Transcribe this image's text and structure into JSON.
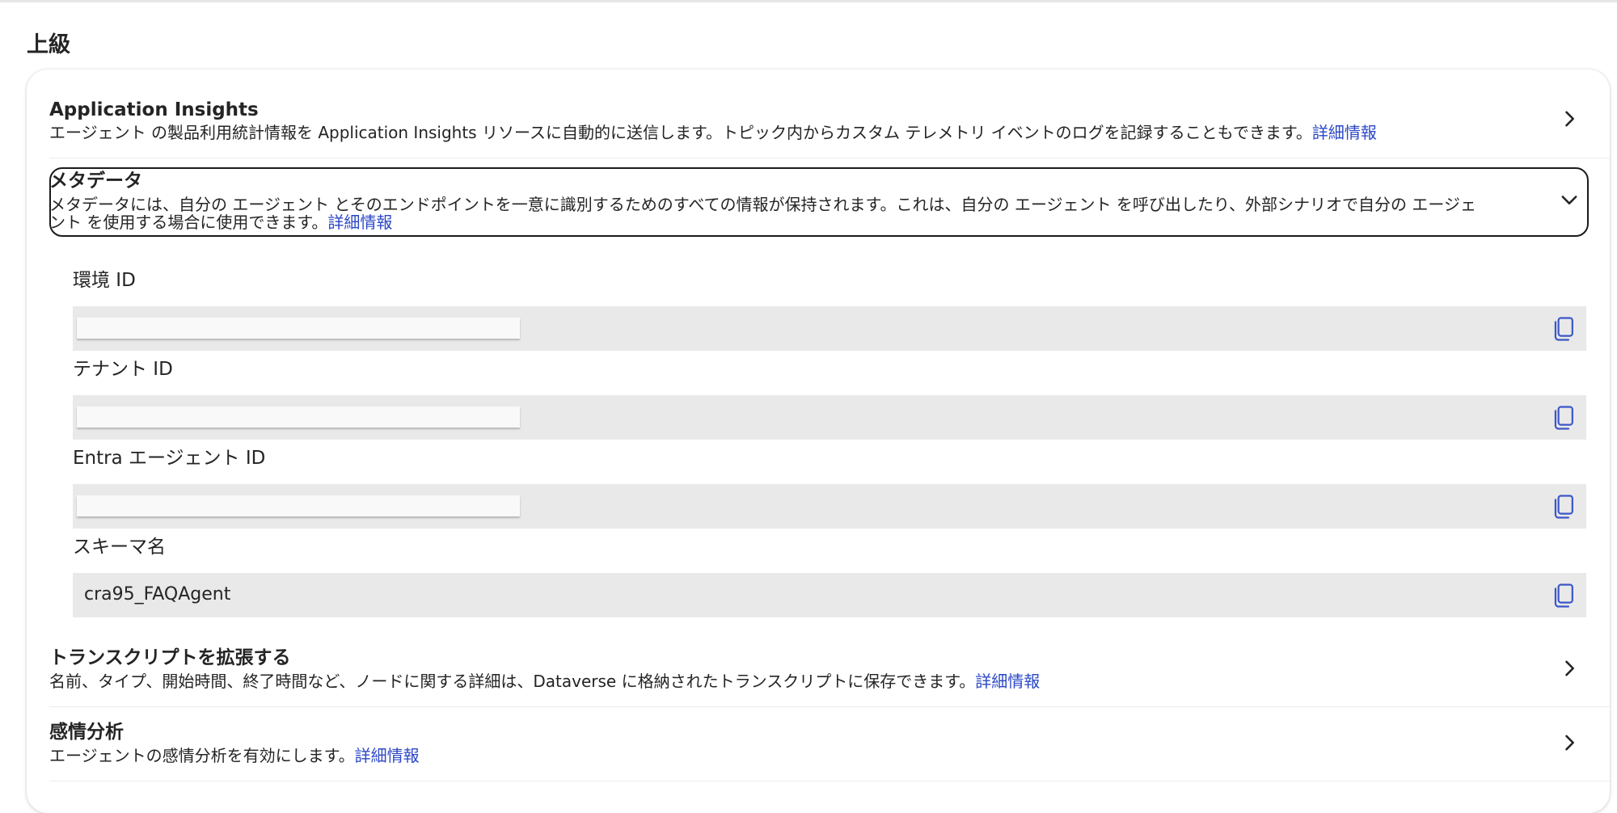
{
  "section": {
    "title": "上級"
  },
  "colors": {
    "link": "#2b47c6",
    "field_background": "#e9e9e9",
    "focus_border": "#1a1a1a"
  },
  "rows": {
    "app_insights": {
      "title": "Application Insights",
      "description": "エージェント の製品利用統計情報を Application Insights リソースに自動的に送信します。トピック内からカスタム テレメトリ イベントのログを記録することもできます。",
      "link": "詳細情報",
      "icon": "chevron-right-icon"
    },
    "metadata": {
      "title": "メタデータ",
      "description_line1": "メタデータには、自分の エージェント とそのエンドポイントを一意に識別するためのすべての情報が保持されます。これは、自分の エージェント を呼び出したり、外部シナリオで自分の エージェ",
      "description_line2": "ント を使用する場合に使用できます。",
      "link": "詳細情報",
      "icon": "chevron-down-icon",
      "expanded": true
    },
    "transcript": {
      "title": "トランスクリプトを拡張する",
      "description": "名前、タイプ、開始時間、終了時間など、ノードに関する詳細は、Dataverse に格納されたトランスクリプトに保存できます。",
      "link": "詳細情報",
      "icon": "chevron-right-icon"
    },
    "sentiment": {
      "title": "感情分析",
      "description": "エージェントの感情分析を有効にします。",
      "link": "詳細情報",
      "icon": "chevron-right-icon"
    }
  },
  "fields": {
    "environment_id": {
      "label": "環境 ID",
      "value": "",
      "redacted": true,
      "icon": "copy-icon"
    },
    "tenant_id": {
      "label": "テナント ID",
      "value": "",
      "redacted": true,
      "icon": "copy-icon"
    },
    "entra_agent_id": {
      "label": "Entra エージェント ID",
      "value": "",
      "redacted": true,
      "icon": "copy-icon"
    },
    "schema_name": {
      "label": "スキーマ名",
      "value": "cra95_FAQAgent",
      "redacted": false,
      "icon": "copy-icon"
    }
  }
}
